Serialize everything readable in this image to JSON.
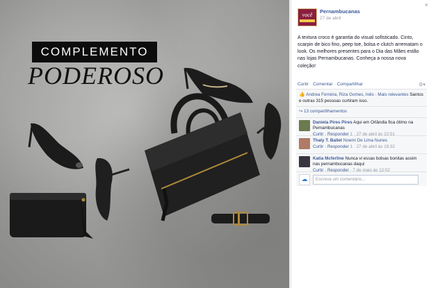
{
  "photo": {
    "headline_top": "COMPLEMENTO",
    "headline_bottom": "PODEROSO"
  },
  "post": {
    "page_name": "Pernambucanas",
    "page_logo_text": "você",
    "date": "27 de abril",
    "text": "A textura croco é garantia do visual sofisticado. Cinto, scarpin de bico fino, peep toe, bolsa e clutch arrematam o look. Os melhores presentes para o Dia das Mães estão nas lojas Pernambucanas. Conheça a nossa nova coleção!",
    "actions": [
      "Curtir",
      "Comentar",
      "Compartilhar"
    ]
  },
  "likes": {
    "names": "Andrea Ferreira, Riza Gomes, Inês",
    "more_link": "Mais relevantes",
    "rest": "Santos e outras 315 pessoas curtiram isso."
  },
  "shares": {
    "label": "13 compartilhamentos"
  },
  "comments": [
    {
      "author": "Daniela Pires Pires",
      "text": "Aqui em Orlândia fica ótimo na Pernambucanas",
      "actions": "Curtir · Responder",
      "meta": "1 · 27 de abril às 22:51",
      "avatar_color": "#6b7a4f"
    },
    {
      "author": "Thaly T. Ballet",
      "text": "Noemi De Lima Nunes",
      "actions": "Curtir · Responder",
      "meta": "1 · 27 de abril às 19:32",
      "avatar_color": "#b07a66"
    },
    {
      "author": "Katia Mcferline",
      "text": "Nunca vi essas bolsas bonitas assim nas pernambucanas daqui",
      "actions": "Curtir · Responder",
      "meta": "· 7 de maio às 12:02",
      "avatar_color": "#3a3440"
    }
  ],
  "write_comment": {
    "placeholder": "Escreva um comentário..."
  },
  "colors": {
    "accent": "#3b5998",
    "brand": "#8a1f3d",
    "feedback_bg": "#f6f7f8"
  }
}
